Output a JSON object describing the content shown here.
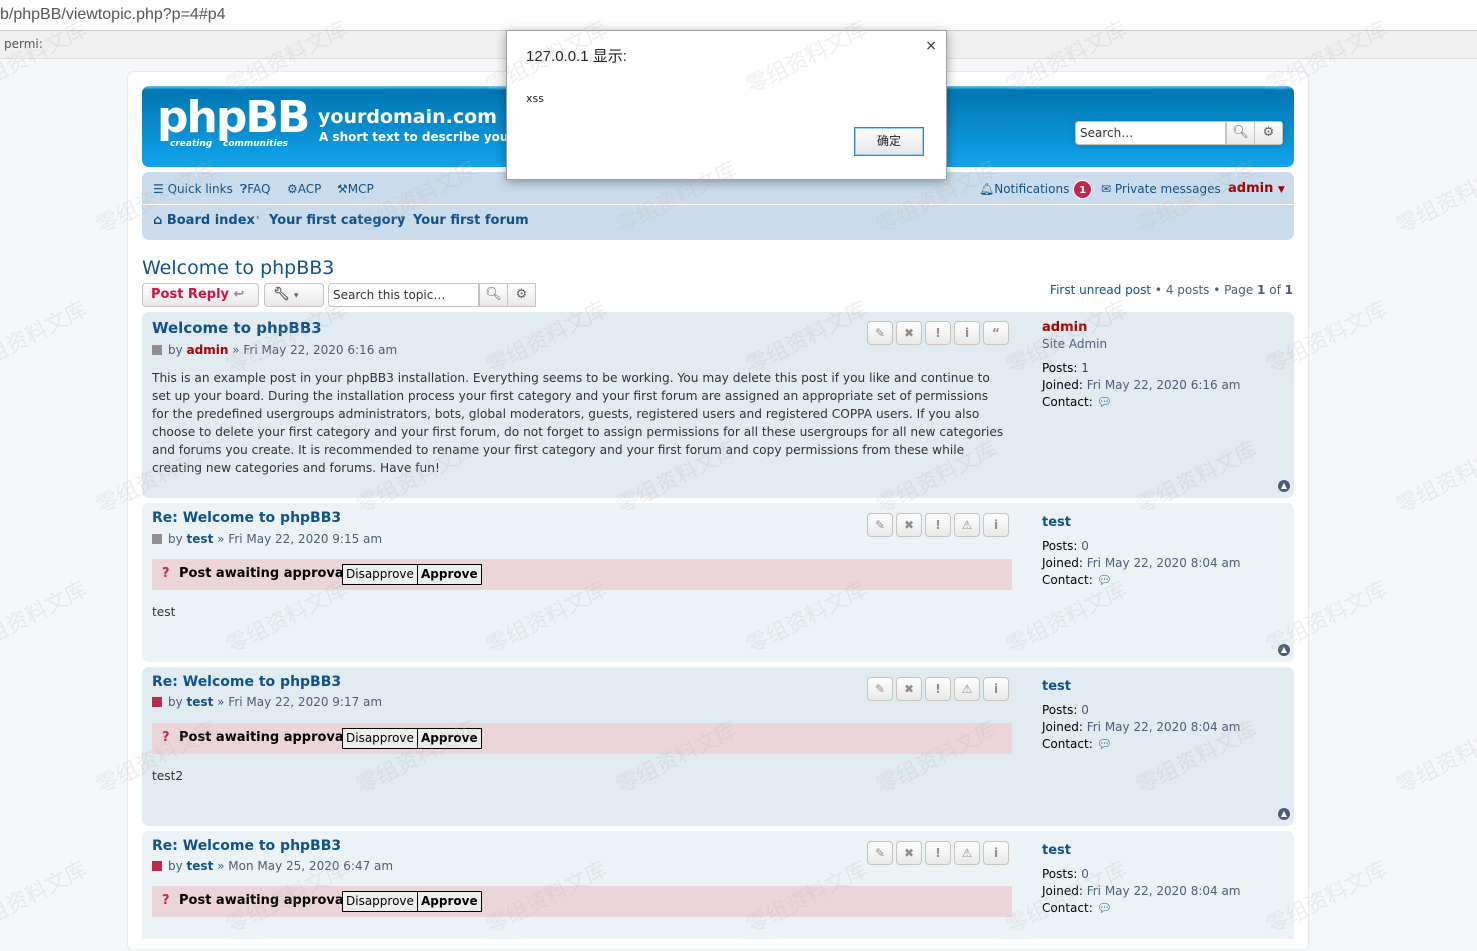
{
  "browser": {
    "url": "b/phpBB/viewtopic.php?p=4#p4",
    "bookmark": "permi:"
  },
  "header": {
    "logo_text": "phpBB",
    "logo_sub1": "creating",
    "logo_sub2": "communities",
    "site_name": "yourdomain.com",
    "site_desc": "A short text to describe your forum",
    "search_placeholder": "Search…"
  },
  "nav": {
    "quick_links": "Quick links",
    "faq": "FAQ",
    "acp": "ACP",
    "mcp": "MCP",
    "notifications": "Notifications",
    "notifications_count": "1",
    "private_messages": "Private messages",
    "username": "admin"
  },
  "breadcrumbs": [
    "Board index",
    "Your first category",
    "Your first forum"
  ],
  "topic": {
    "title": "Welcome to phpBB3",
    "post_reply": "Post Reply",
    "search_placeholder": "Search this topic…",
    "first_unread": "First unread post",
    "posts_count": "4 posts",
    "page_label": "Page",
    "page_current": "1",
    "page_of": "of",
    "page_total": "1"
  },
  "posts": [
    {
      "title": "Welcome to phpBB3",
      "by": "by",
      "author": "admin",
      "date": "» Fri May 22, 2020 6:16 am",
      "content": "This is an example post in your phpBB3 installation. Everything seems to be working. You may delete this post if you like and continue to set up your board. During the installation process your first category and your first forum are assigned an appropriate set of permissions for the predefined usergroups administrators, bots, global moderators, guests, registered users and registered COPPA users. If you also choose to delete your first category and your first forum, do not forget to assign permissions for all these usergroups for all new categories and forums you create. It is recommended to rename your first category and your first forum and copy permissions from these while creating new categories and forums. Have fun!",
      "profile_name": "admin",
      "rank": "Site Admin",
      "posts_label": "Posts:",
      "posts": "1",
      "joined_label": "Joined:",
      "joined": "Fri May 22, 2020 6:16 am",
      "contact_label": "Contact:"
    },
    {
      "title": "Re: Welcome to phpBB3",
      "by": "by",
      "author": "test",
      "date": "» Fri May 22, 2020 9:15 am",
      "approval_label": "Post awaiting approval:",
      "disapprove": "Disapprove",
      "approve": "Approve",
      "content": "test",
      "profile_name": "test",
      "posts_label": "Posts:",
      "posts": "0",
      "joined_label": "Joined:",
      "joined": "Fri May 22, 2020 8:04 am",
      "contact_label": "Contact:"
    },
    {
      "title": "Re: Welcome to phpBB3",
      "by": "by",
      "author": "test",
      "date": "» Fri May 22, 2020 9:17 am",
      "approval_label": "Post awaiting approval:",
      "disapprove": "Disapprove",
      "approve": "Approve",
      "content": "test2",
      "profile_name": "test",
      "posts_label": "Posts:",
      "posts": "0",
      "joined_label": "Joined:",
      "joined": "Fri May 22, 2020 8:04 am",
      "contact_label": "Contact:"
    },
    {
      "title": "Re: Welcome to phpBB3",
      "by": "by",
      "author": "test",
      "date": "» Mon May 25, 2020 6:47 am",
      "approval_label": "Post awaiting approval:",
      "disapprove": "Disapprove",
      "approve": "Approve",
      "profile_name": "test",
      "posts_label": "Posts:",
      "posts": "0",
      "joined_label": "Joined:",
      "joined": "Fri May 22, 2020 8:04 am",
      "contact_label": "Contact:"
    }
  ],
  "dialog": {
    "title": "127.0.0.1 显示:",
    "message": "xss",
    "ok": "确定",
    "close": "×"
  },
  "watermark": "零组资料文库"
}
